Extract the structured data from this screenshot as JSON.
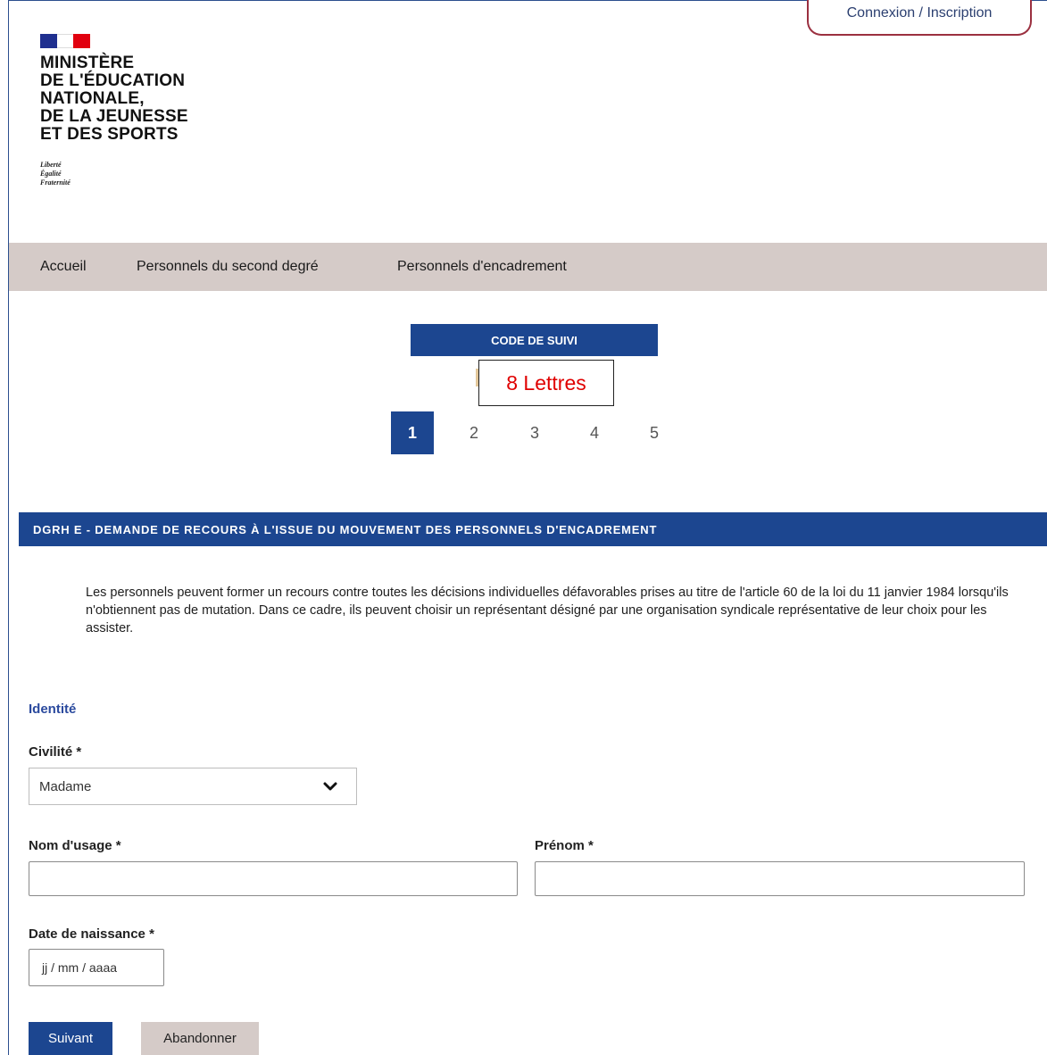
{
  "header": {
    "ministry_name": "MINISTÈRE\nDE L'ÉDUCATION\nNATIONALE,\nDE LA JEUNESSE\nET DES SPORTS",
    "motto": "Liberté\nÉgalité\nFraternité",
    "login_label": "Connexion / Inscription"
  },
  "nav": {
    "items": [
      {
        "label": "Accueil"
      },
      {
        "label": "Personnels du second degré"
      },
      {
        "label": "Personnels d'encadrement"
      }
    ]
  },
  "tracking": {
    "title": "CODE DE SUIVI",
    "annotation": "8 Lettres"
  },
  "steps": {
    "items": [
      "1",
      "2",
      "3",
      "4",
      "5"
    ],
    "active": "1"
  },
  "section": {
    "title": "DGRH E - DEMANDE DE RECOURS À L'ISSUE DU MOUVEMENT DES PERSONNELS D'ENCADREMENT",
    "intro": "Les personnels peuvent former un recours contre toutes les décisions individuelles défavorables prises au titre de l'article 60 de la loi du 11 janvier 1984 lorsqu'ils n'obtiennent pas de mutation. Dans ce cadre, ils peuvent choisir un représentant désigné par une organisation syndicale représentative de leur choix pour les assister."
  },
  "form": {
    "group_title": "Identité",
    "civility_label": "Civilité *",
    "civility_value": "Madame",
    "lastname_label": "Nom d'usage *",
    "lastname_value": "",
    "firstname_label": "Prénom *",
    "firstname_value": "",
    "birthdate_label": "Date de naissance *",
    "birthdate_placeholder": "jj / mm / aaaa"
  },
  "actions": {
    "next_label": "Suivant",
    "cancel_label": "Abandonner"
  },
  "colors": {
    "primary_blue": "#1c4690",
    "nav_bg": "#d5cbc8",
    "annotation_red": "#e00000",
    "login_border": "#9b3040"
  }
}
